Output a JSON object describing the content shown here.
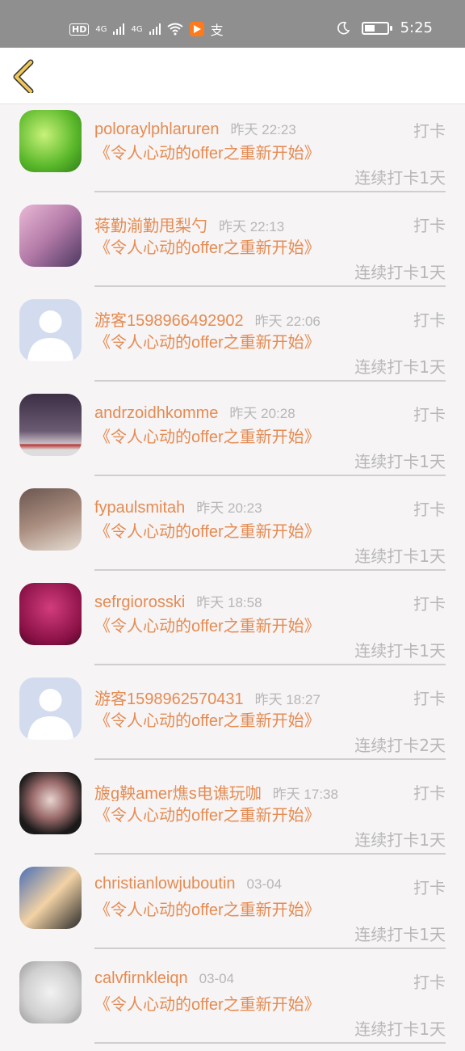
{
  "status_bar": {
    "left_icons": [
      "hd-icon",
      "signal-4g-icon",
      "signal-4g-icon",
      "wifi-icon",
      "app-icon",
      "alipay-icon"
    ],
    "hd_label": "HD",
    "net1": "4G",
    "net2": "4G",
    "time": "5:25"
  },
  "header": {
    "back_icon": "back-chevron-icon"
  },
  "colors": {
    "accent": "#e58b52",
    "muted": "#b7b7b7",
    "bg": "#f6f4f5",
    "back_icon": "#e3b54b"
  },
  "items": [
    {
      "name": "poloraylphlaruren",
      "time": "昨天 22:23",
      "action": "打卡",
      "title": "《令人心动的offer之重新开始》",
      "streak": "连续打卡1天",
      "avatar": "green-leaf-avatar"
    },
    {
      "name": "蒋勤湔勤甩梨勺",
      "time": "昨天 22:13",
      "action": "打卡",
      "title": "《令人心动的offer之重新开始》",
      "streak": "连续打卡1天",
      "avatar": "pink-hair-avatar"
    },
    {
      "name": "游客1598966492902",
      "time": "昨天 22:06",
      "action": "打卡",
      "title": "《令人心动的offer之重新开始》",
      "streak": "连续打卡1天",
      "avatar": "default-user-avatar"
    },
    {
      "name": "andrzoidhkomme",
      "time": "昨天 20:28",
      "action": "打卡",
      "title": "《令人心动的offer之重新开始》",
      "streak": "连续打卡1天",
      "avatar": "girl-portrait-avatar"
    },
    {
      "name": "fypaulsmitah",
      "time": "昨天 20:23",
      "action": "打卡",
      "title": "《令人心动的offer之重新开始》",
      "streak": "连续打卡1天",
      "avatar": "woman-fur-avatar"
    },
    {
      "name": "sefrgiorosski",
      "time": "昨天 18:58",
      "action": "打卡",
      "title": "《令人心动的offer之重新开始》",
      "streak": "连续打卡1天",
      "avatar": "magenta-poster-avatar"
    },
    {
      "name": "游客1598962570431",
      "time": "昨天 18:27",
      "action": "打卡",
      "title": "《令人心动的offer之重新开始》",
      "streak": "连续打卡2天",
      "avatar": "default-user-avatar"
    },
    {
      "name": "旇g鞅amer燋s电谯玩咖",
      "time": "昨天 17:38",
      "action": "打卡",
      "title": "《令人心动的offer之重新开始》",
      "streak": "连续打卡1天",
      "avatar": "face-paint-avatar"
    },
    {
      "name": "christianlowjuboutin",
      "time": "03-04",
      "action": "打卡",
      "title": "《令人心动的offer之重新开始》",
      "streak": "连续打卡1天",
      "avatar": "anime-avatar"
    },
    {
      "name": "calvfirnkleiqn",
      "time": "03-04",
      "action": "打卡",
      "title": "《令人心动的offer之重新开始》",
      "streak": "连续打卡1天",
      "avatar": "chair-figure-avatar"
    }
  ]
}
